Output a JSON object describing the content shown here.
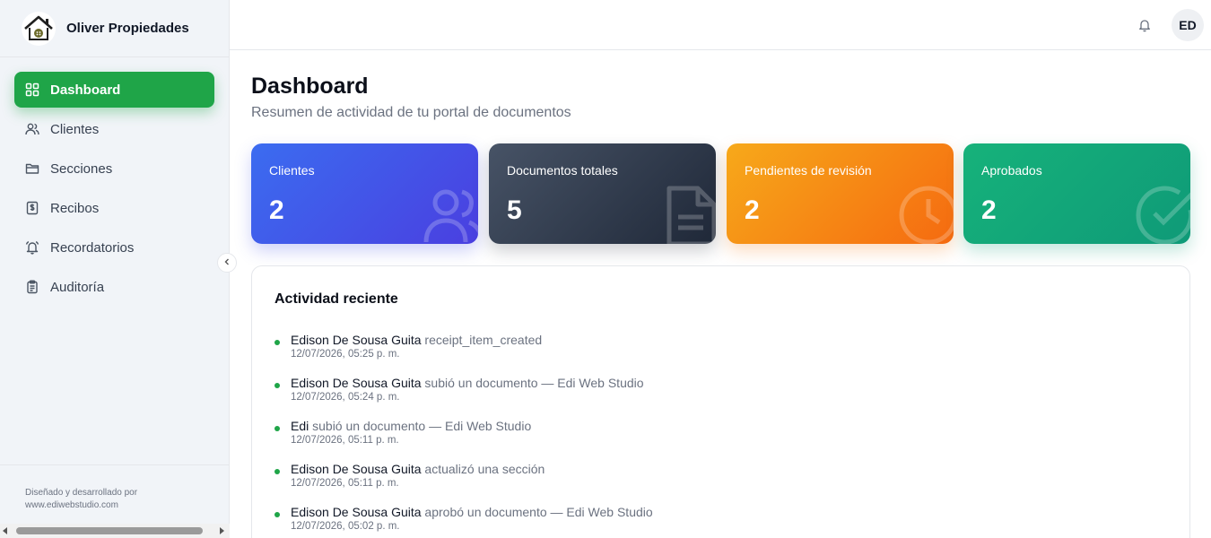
{
  "brand": {
    "name": "Oliver Propiedades"
  },
  "sidebar": {
    "items": [
      {
        "label": "Dashboard",
        "icon": "grid-icon",
        "active": true
      },
      {
        "label": "Clientes",
        "icon": "users-icon",
        "active": false
      },
      {
        "label": "Secciones",
        "icon": "folder-icon",
        "active": false
      },
      {
        "label": "Recibos",
        "icon": "receipt-icon",
        "active": false
      },
      {
        "label": "Recordatorios",
        "icon": "bell-icon",
        "active": false
      },
      {
        "label": "Auditoría",
        "icon": "clipboard-icon",
        "active": false
      }
    ],
    "footer": {
      "line1": "Diseñado y desarrollado por",
      "line2": "www.ediwebstudio.com"
    }
  },
  "header": {
    "avatar_initials": "ED"
  },
  "page": {
    "title": "Dashboard",
    "subtitle": "Resumen de actividad de tu portal de documentos"
  },
  "stats": [
    {
      "label": "Clientes",
      "value": "2",
      "icon": "users-icon"
    },
    {
      "label": "Documentos totales",
      "value": "5",
      "icon": "document-icon"
    },
    {
      "label": "Pendientes de revisión",
      "value": "2",
      "icon": "clock-icon"
    },
    {
      "label": "Aprobados",
      "value": "2",
      "icon": "check-circle-icon"
    }
  ],
  "activity": {
    "title": "Actividad reciente",
    "items": [
      {
        "who": "Edison De Sousa Guita",
        "what": "receipt_item_created",
        "when": "12/07/2026, 05:25 p. m."
      },
      {
        "who": "Edison De Sousa Guita",
        "what": "subió un documento — Edi Web Studio",
        "when": "12/07/2026, 05:24 p. m."
      },
      {
        "who": "Edi",
        "what": "subió un documento — Edi Web Studio",
        "when": "12/07/2026, 05:11 p. m."
      },
      {
        "who": "Edison De Sousa Guita",
        "what": "actualizó una sección",
        "when": "12/07/2026, 05:11 p. m."
      },
      {
        "who": "Edison De Sousa Guita",
        "what": "aprobó un documento — Edi Web Studio",
        "when": "12/07/2026, 05:02 p. m."
      }
    ]
  },
  "colors": {
    "accent": "#1fa548",
    "sidebar_bg": "#f1f4f8"
  }
}
